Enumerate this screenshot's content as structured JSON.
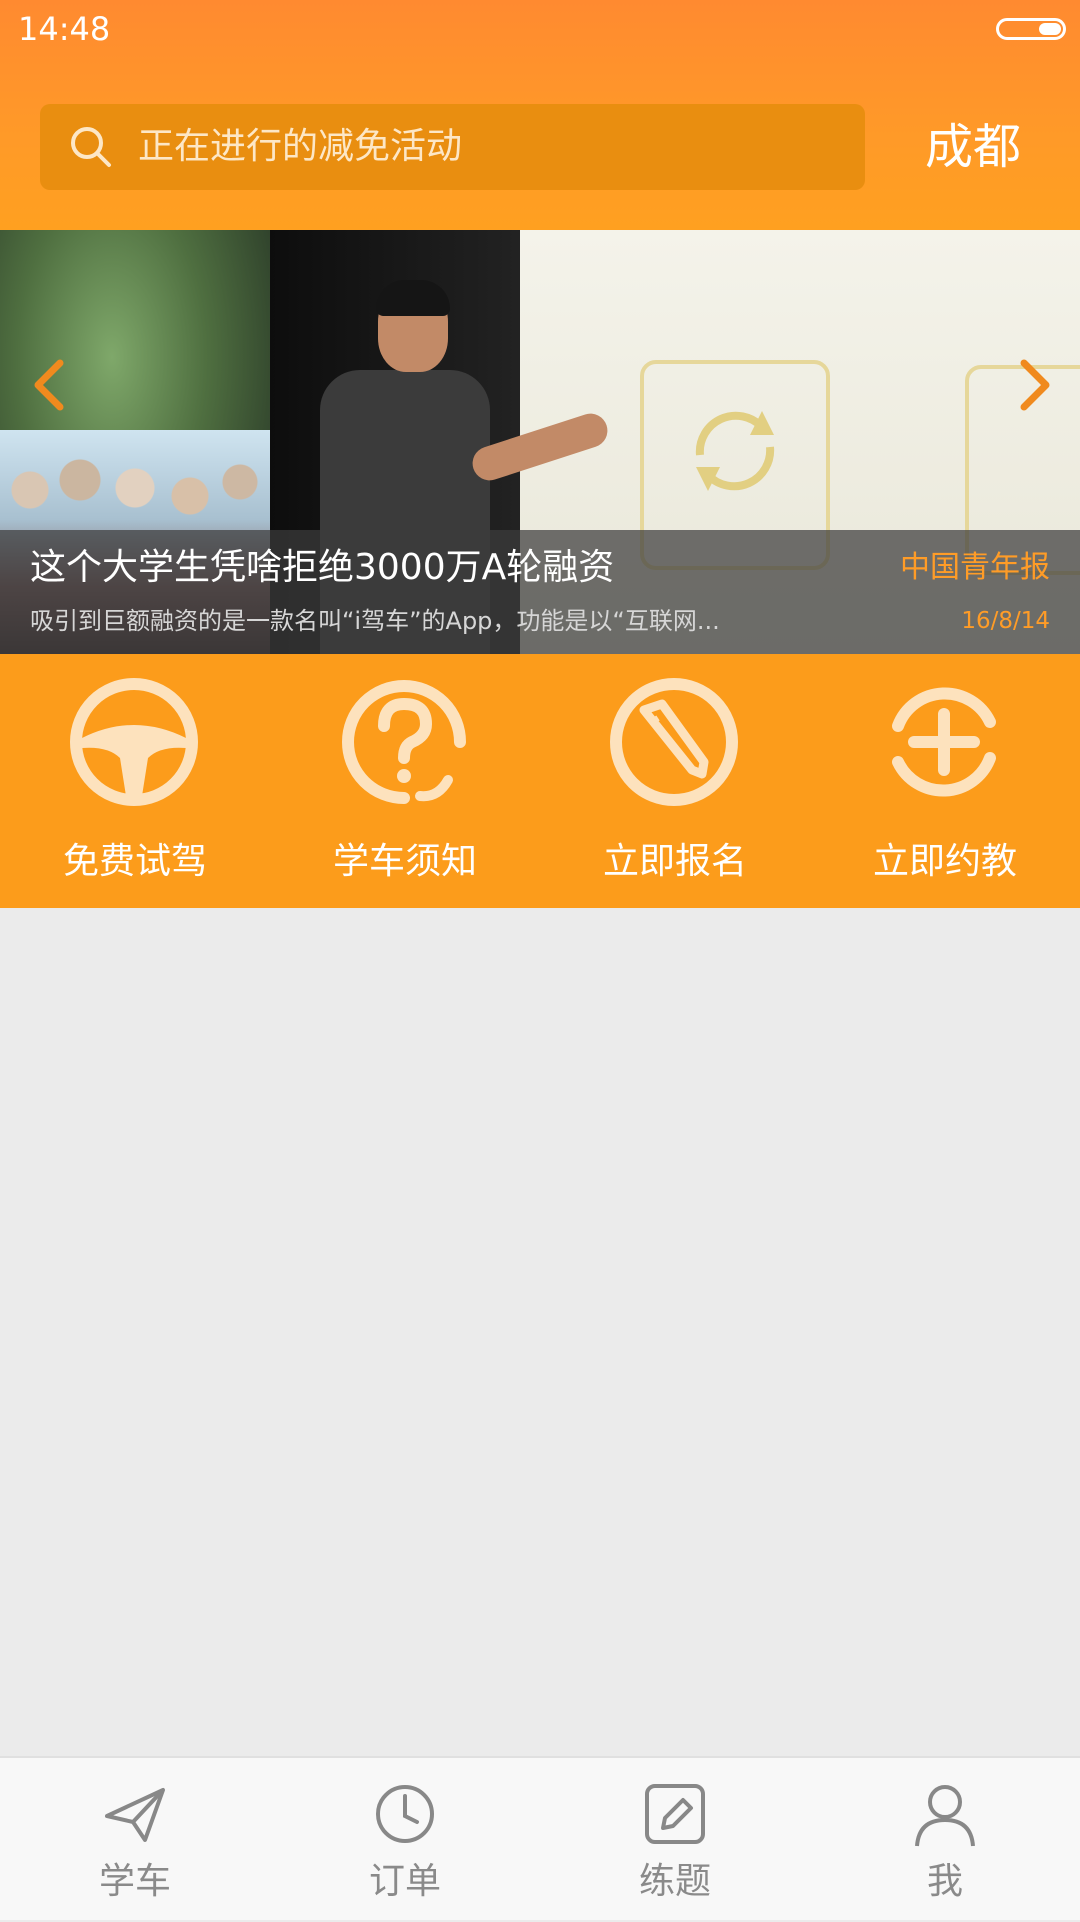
{
  "status_bar": {
    "time": "14:48"
  },
  "search": {
    "placeholder": "正在进行的减免活动",
    "city": "成都"
  },
  "banner": {
    "title": "这个大学生凭啥拒绝3000万A轮融资",
    "source": "中国青年报",
    "description": "吸引到巨额融资的是一款名叫“i驾车”的App，功能是以“互联网...",
    "date": "16/8/14"
  },
  "quick_actions": [
    {
      "label": "免费试驾",
      "icon": "steering-wheel-icon"
    },
    {
      "label": "学车须知",
      "icon": "question-icon"
    },
    {
      "label": "立即报名",
      "icon": "pen-icon"
    },
    {
      "label": "立即约教",
      "icon": "add-appointment-icon"
    }
  ],
  "tabs": [
    {
      "label": "学车",
      "icon": "paper-plane-icon"
    },
    {
      "label": "订单",
      "icon": "clock-icon"
    },
    {
      "label": "练题",
      "icon": "edit-icon"
    },
    {
      "label": "我",
      "icon": "user-icon"
    }
  ],
  "colors": {
    "accent": "#fc9c1b",
    "header": "#ff8a30",
    "caption_accent": "#ff9c27"
  }
}
